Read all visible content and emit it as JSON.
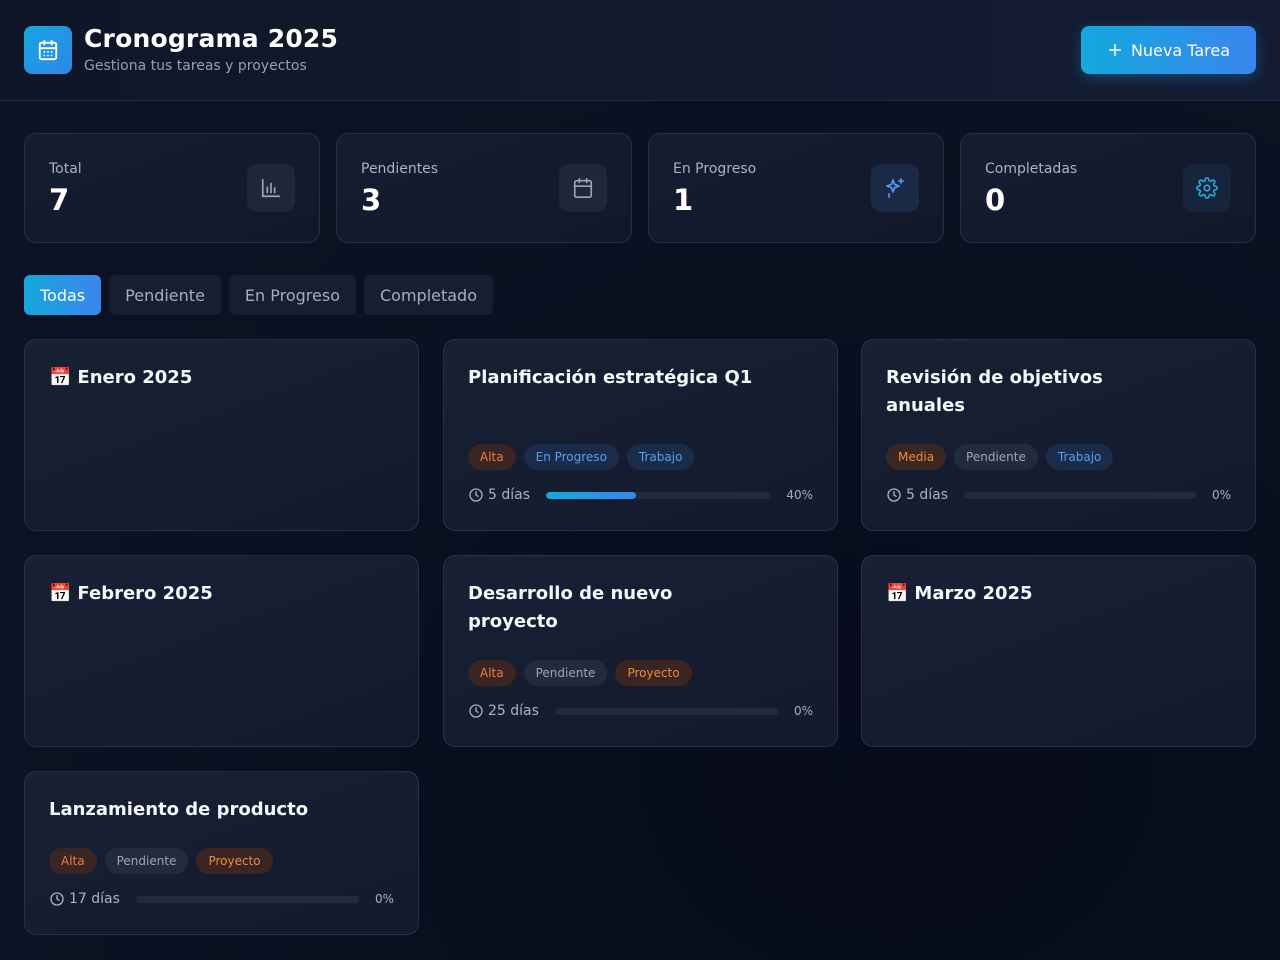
{
  "header": {
    "title": "Cronograma 2025",
    "subtitle": "Gestiona tus tareas y proyectos",
    "new_task_label": "Nueva Tarea",
    "logo_icon": "calendar-icon"
  },
  "stats": [
    {
      "label": "Total",
      "value": "7",
      "icon": "bar-chart-icon"
    },
    {
      "label": "Pendientes",
      "value": "3",
      "icon": "calendar-icon"
    },
    {
      "label": "En Progreso",
      "value": "1",
      "icon": "sparkles-icon"
    },
    {
      "label": "Completadas",
      "value": "0",
      "icon": "gear-icon"
    }
  ],
  "filters": [
    "Todas",
    "Pendiente",
    "En Progreso",
    "Completado"
  ],
  "active_filter": "Todas",
  "months": [
    "Enero 2025",
    "Febrero 2025",
    "Marzo 2025"
  ],
  "tasks": [
    {
      "title": "Planificación estratégica Q1",
      "priority": "Alta",
      "status": "En Progreso",
      "category": "Trabajo",
      "duration": "5 días",
      "progress": 40,
      "progress_label": "40%"
    },
    {
      "title": "Revisión de objetivos anuales",
      "priority": "Media",
      "status": "Pendiente",
      "category": "Trabajo",
      "duration": "5 días",
      "progress": 0,
      "progress_label": "0%"
    },
    {
      "title": "Desarrollo de nuevo proyecto",
      "priority": "Alta",
      "status": "Pendiente",
      "category": "Proyecto",
      "duration": "25 días",
      "progress": 0,
      "progress_label": "0%"
    },
    {
      "title": "Lanzamiento de producto",
      "priority": "Alta",
      "status": "Pendiente",
      "category": "Proyecto",
      "duration": "17 días",
      "progress": 0,
      "progress_label": "0%"
    }
  ],
  "colors": {
    "accent_start": "#14a8dc",
    "accent_end": "#3a86ee",
    "priority_high": "#f07a3a",
    "status_progress": "#52a2ee"
  }
}
